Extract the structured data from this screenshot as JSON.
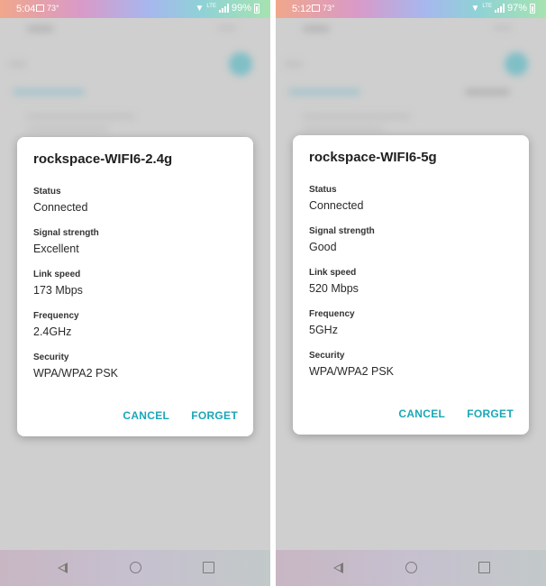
{
  "colors": {
    "accent": "#1aa7b7",
    "scrim": "#cfcfcf",
    "dialog_bg": "#ffffff"
  },
  "phones": [
    {
      "status": {
        "time": "5:04",
        "temp": "73°",
        "network": "LTE",
        "battery": "99%"
      },
      "dialog": {
        "title": "rockspace-WIFI6-2.4g",
        "fields": [
          {
            "label": "Status",
            "value": "Connected"
          },
          {
            "label": "Signal strength",
            "value": "Excellent"
          },
          {
            "label": "Link speed",
            "value": "173 Mbps"
          },
          {
            "label": "Frequency",
            "value": "2.4GHz"
          },
          {
            "label": "Security",
            "value": "WPA/WPA2 PSK"
          }
        ],
        "cancel_label": "CANCEL",
        "forget_label": "FORGET"
      }
    },
    {
      "status": {
        "time": "5:12",
        "temp": "73°",
        "network": "LTE",
        "battery": "97%"
      },
      "dialog": {
        "title": "rockspace-WIFI6-5g",
        "fields": [
          {
            "label": "Status",
            "value": "Connected"
          },
          {
            "label": "Signal strength",
            "value": "Good"
          },
          {
            "label": "Link speed",
            "value": "520 Mbps"
          },
          {
            "label": "Frequency",
            "value": "5GHz"
          },
          {
            "label": "Security",
            "value": "WPA/WPA2 PSK"
          }
        ],
        "cancel_label": "CANCEL",
        "forget_label": "FORGET"
      }
    }
  ]
}
